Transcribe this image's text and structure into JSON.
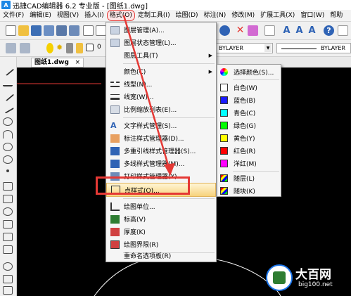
{
  "window": {
    "title": "迅捷CAD编辑器 6.2 专业版 - [图纸1.dwg]",
    "logo_letter": "A"
  },
  "menubar": {
    "items": [
      {
        "label": "文件(F)"
      },
      {
        "label": "编辑(E)"
      },
      {
        "label": "视图(V)"
      },
      {
        "label": "插入(I)"
      },
      {
        "label": "格式(O)"
      },
      {
        "label": "定制工具(I)"
      },
      {
        "label": "绘图(D)"
      },
      {
        "label": "标注(N)"
      },
      {
        "label": "修改(M)"
      },
      {
        "label": "扩展工具(X)"
      },
      {
        "label": "窗口(W)"
      },
      {
        "label": "帮助"
      }
    ],
    "active_index": 4
  },
  "toolbar2": {
    "layer_value": "0",
    "bylayer_1": "BYLAYER",
    "bylayer_2": "BYLAYER"
  },
  "document_tab": {
    "label": "图纸1.dwg",
    "close": "×"
  },
  "format_menu": {
    "items": [
      {
        "label": "图层管理(A)...",
        "icon": "layer-manager-icon"
      },
      {
        "label": "图层状态管理(L)...",
        "icon": "layer-state-icon"
      },
      {
        "label": "图层工具(T)",
        "icon": "layer-tools-icon",
        "submenu": true
      },
      {
        "label": "颜色(C)",
        "icon": "color-icon",
        "submenu": true
      },
      {
        "label": "线型(N)...",
        "icon": "linetype-icon"
      },
      {
        "label": "线宽(W)...",
        "icon": "lineweight-icon"
      },
      {
        "label": "比例缩放列表(E)...",
        "icon": "scale-list-icon"
      },
      {
        "label": "文字样式管理(S)...",
        "icon": "text-style-icon"
      },
      {
        "label": "标注样式管理器(D)...",
        "icon": "dim-style-icon"
      },
      {
        "label": "多重引线样式管理器(S)...",
        "icon": "mleader-style-icon"
      },
      {
        "label": "多线样式管理器(M)...",
        "icon": "mline-style-icon"
      },
      {
        "label": "打印样式管理器(Y)...",
        "icon": "plot-style-icon"
      },
      {
        "label": "点样式(O)...",
        "icon": "point-style-icon"
      },
      {
        "label": "绘图单位...",
        "icon": "units-icon"
      },
      {
        "label": "标高(V)",
        "icon": "elevation-icon"
      },
      {
        "label": "厚度(K)",
        "icon": "thickness-icon"
      },
      {
        "label": "绘图界限(R)",
        "icon": "drawing-limits-icon"
      },
      {
        "label": "重命名选项板(R)",
        "icon": "rename-icon"
      }
    ],
    "highlighted": "点样式(O)..."
  },
  "color_submenu": {
    "items": [
      {
        "label": "选择颜色(S)...",
        "color": "#ffffff"
      },
      {
        "label": "白色(W)",
        "color": "#ffffff"
      },
      {
        "label": "蓝色(B)",
        "color": "#1a1aff"
      },
      {
        "label": "青色(C)",
        "color": "#00ffff"
      },
      {
        "label": "绿色(G)",
        "color": "#00ff00"
      },
      {
        "label": "黄色(Y)",
        "color": "#ffff00"
      },
      {
        "label": "红色(R)",
        "color": "#ff0000"
      },
      {
        "label": "洋红(M)",
        "color": "#ff00ff"
      },
      {
        "label": "随层(L)",
        "color": "#888888"
      },
      {
        "label": "随块(K)",
        "color": "#888888"
      }
    ]
  },
  "colors": {
    "annotation_red": "#e53935",
    "canvas": "#000000",
    "menu_bg": "#f5f5f5"
  },
  "watermark": {
    "title": "大百网",
    "subtitle": "big100.net"
  }
}
